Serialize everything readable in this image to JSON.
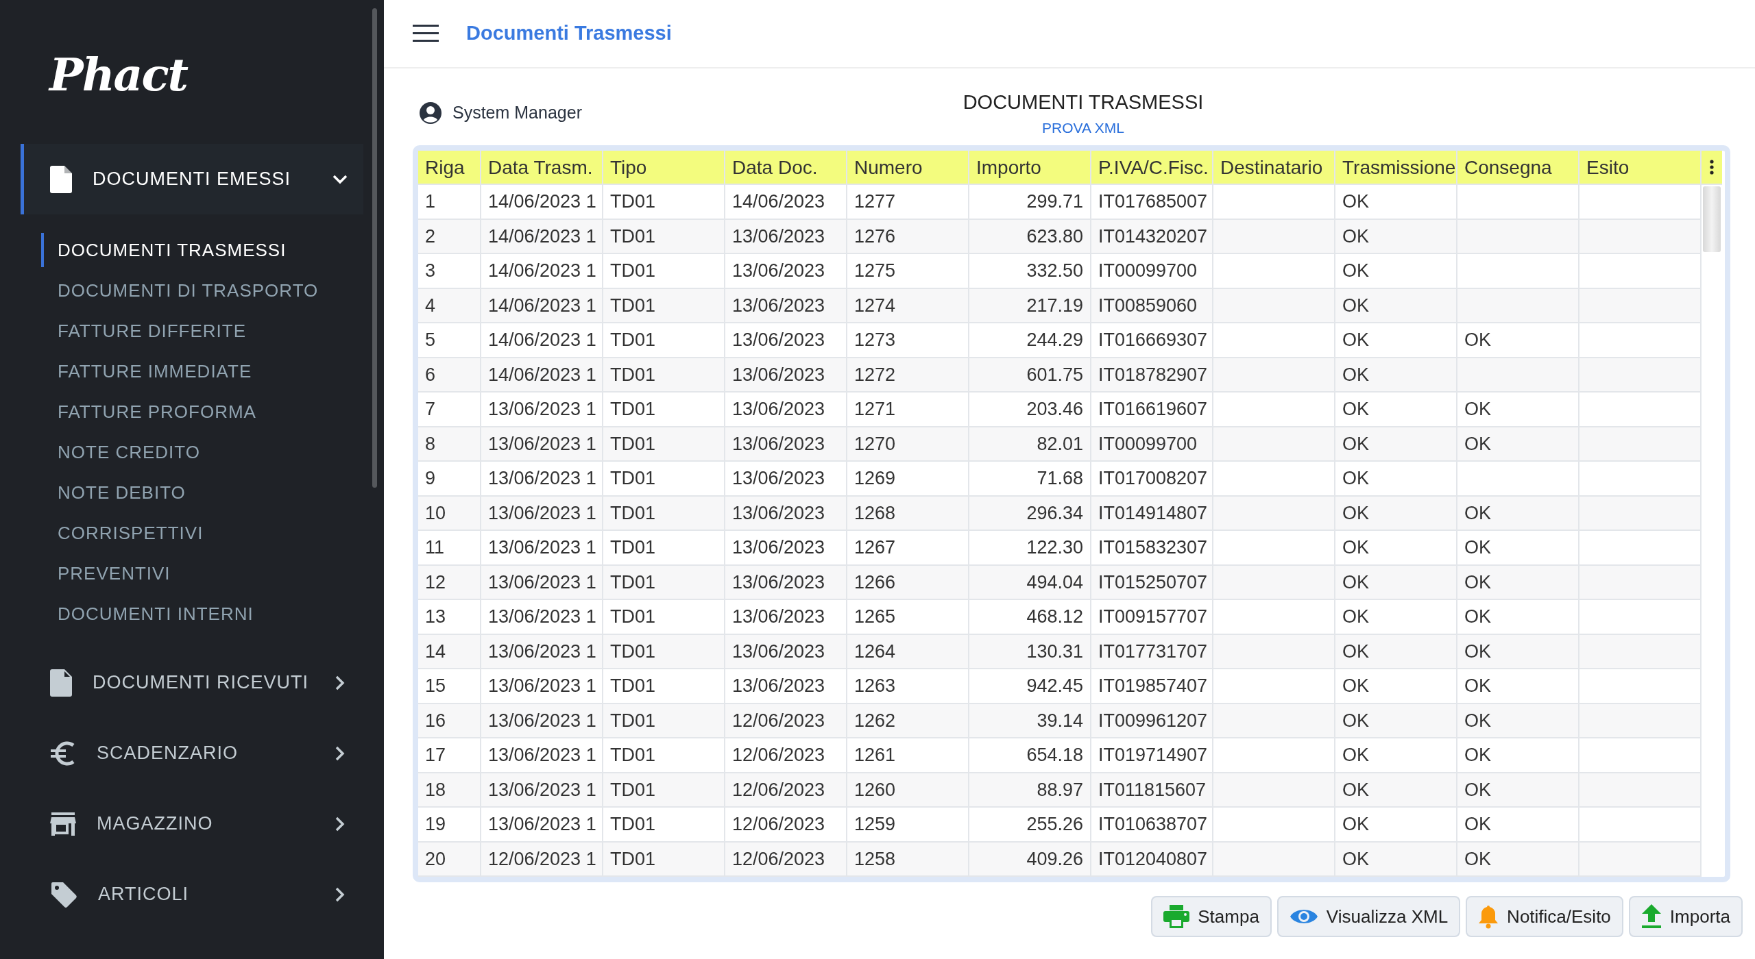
{
  "sidebar": {
    "logo": "Phact",
    "groups": [
      {
        "label": "DOCUMENTI EMESSI",
        "expanded": true,
        "items": [
          {
            "label": "DOCUMENTI TRASMESSI",
            "selected": true
          },
          {
            "label": "DOCUMENTI DI TRASPORTO",
            "selected": false
          },
          {
            "label": "FATTURE DIFFERITE",
            "selected": false
          },
          {
            "label": "FATTURE IMMEDIATE",
            "selected": false
          },
          {
            "label": "FATTURE PROFORMA",
            "selected": false
          },
          {
            "label": "NOTE CREDITO",
            "selected": false
          },
          {
            "label": "NOTE DEBITO",
            "selected": false
          },
          {
            "label": "CORRISPETTIVI",
            "selected": false
          },
          {
            "label": "PREVENTIVI",
            "selected": false
          },
          {
            "label": "DOCUMENTI INTERNI",
            "selected": false
          }
        ]
      },
      {
        "label": "DOCUMENTI RICEVUTI",
        "expanded": false
      },
      {
        "label": "SCADENZARIO",
        "expanded": false
      },
      {
        "label": "MAGAZZINO",
        "expanded": false
      },
      {
        "label": "ARTICOLI",
        "expanded": false
      }
    ]
  },
  "header": {
    "title": "Documenti Trasmessi"
  },
  "user": "System Manager",
  "page": {
    "title": "DOCUMENTI TRASMESSI",
    "subtitle": "PROVA XML"
  },
  "table": {
    "columns": [
      "Riga",
      "Data Trasm.",
      "Tipo",
      "Data Doc.",
      "Numero",
      "Importo",
      "P.IVA/C.Fisc.",
      "Destinatario",
      "Trasmissione",
      "Consegna",
      "Esito"
    ],
    "rows": [
      [
        "1",
        "14/06/2023 1",
        "TD01",
        "14/06/2023",
        "1277",
        "299.71",
        "IT017685007",
        null,
        "OK",
        null,
        null
      ],
      [
        "2",
        "14/06/2023 1",
        "TD01",
        "13/06/2023",
        "1276",
        "623.80",
        "IT014320207",
        null,
        "OK",
        null,
        null
      ],
      [
        "3",
        "14/06/2023 1",
        "TD01",
        "13/06/2023",
        "1275",
        "332.50",
        "IT00099700",
        null,
        "OK",
        null,
        null
      ],
      [
        "4",
        "14/06/2023 1",
        "TD01",
        "13/06/2023",
        "1274",
        "217.19",
        "IT00859060",
        null,
        "OK",
        null,
        null
      ],
      [
        "5",
        "14/06/2023 1",
        "TD01",
        "13/06/2023",
        "1273",
        "244.29",
        "IT016669307",
        null,
        "OK",
        "OK",
        null
      ],
      [
        "6",
        "14/06/2023 1",
        "TD01",
        "13/06/2023",
        "1272",
        "601.75",
        "IT018782907",
        null,
        "OK",
        null,
        null
      ],
      [
        "7",
        "13/06/2023 1",
        "TD01",
        "13/06/2023",
        "1271",
        "203.46",
        "IT016619607",
        null,
        "OK",
        "OK",
        null
      ],
      [
        "8",
        "13/06/2023 1",
        "TD01",
        "13/06/2023",
        "1270",
        "82.01",
        "IT00099700",
        null,
        "OK",
        "OK",
        null
      ],
      [
        "9",
        "13/06/2023 1",
        "TD01",
        "13/06/2023",
        "1269",
        "71.68",
        "IT017008207",
        null,
        "OK",
        null,
        null
      ],
      [
        "10",
        "13/06/2023 1",
        "TD01",
        "13/06/2023",
        "1268",
        "296.34",
        "IT014914807",
        null,
        "OK",
        "OK",
        null
      ],
      [
        "11",
        "13/06/2023 1",
        "TD01",
        "13/06/2023",
        "1267",
        "122.30",
        "IT015832307",
        null,
        "OK",
        "OK",
        null
      ],
      [
        "12",
        "13/06/2023 1",
        "TD01",
        "13/06/2023",
        "1266",
        "494.04",
        "IT015250707",
        null,
        "OK",
        "OK",
        null
      ],
      [
        "13",
        "13/06/2023 1",
        "TD01",
        "13/06/2023",
        "1265",
        "468.12",
        "IT009157707",
        null,
        "OK",
        "OK",
        null
      ],
      [
        "14",
        "13/06/2023 1",
        "TD01",
        "13/06/2023",
        "1264",
        "130.31",
        "IT017731707",
        null,
        "OK",
        "OK",
        null
      ],
      [
        "15",
        "13/06/2023 1",
        "TD01",
        "13/06/2023",
        "1263",
        "942.45",
        "IT019857407",
        null,
        "OK",
        "OK",
        null
      ],
      [
        "16",
        "13/06/2023 1",
        "TD01",
        "12/06/2023",
        "1262",
        "39.14",
        "IT009961207",
        null,
        "OK",
        "OK",
        null
      ],
      [
        "17",
        "13/06/2023 1",
        "TD01",
        "12/06/2023",
        "1261",
        "654.18",
        "IT019714907",
        null,
        "OK",
        "OK",
        null
      ],
      [
        "18",
        "13/06/2023 1",
        "TD01",
        "12/06/2023",
        "1260",
        "88.97",
        "IT011815607",
        null,
        "OK",
        "OK",
        null
      ],
      [
        "19",
        "13/06/2023 1",
        "TD01",
        "12/06/2023",
        "1259",
        "255.26",
        "IT010638707",
        null,
        "OK",
        "OK",
        null
      ],
      [
        "20",
        "12/06/2023 1",
        "TD01",
        "12/06/2023",
        "1258",
        "409.26",
        "IT012040807",
        null,
        "OK",
        "OK",
        null
      ]
    ]
  },
  "buttons": [
    "Stampa",
    "Visualizza XML",
    "Notifica/Esito",
    "Importa"
  ]
}
